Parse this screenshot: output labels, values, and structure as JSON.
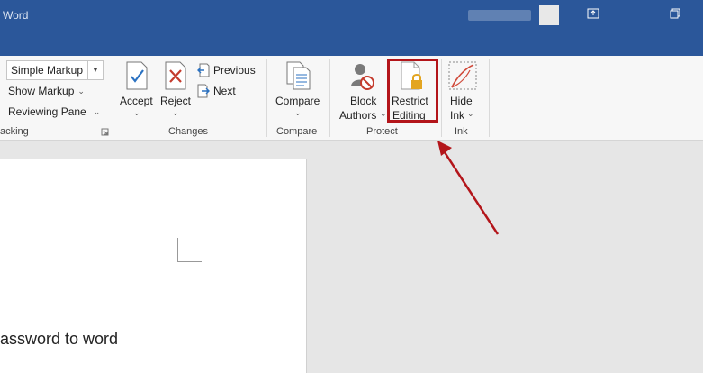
{
  "titlebar": {
    "app_name": "Word",
    "user_name": "",
    "icons": [
      "ribbon-display-icon",
      "restore-icon"
    ]
  },
  "ribbon": {
    "tracking": {
      "markup_select_value": "Simple Markup",
      "show_markup_label": "Show Markup",
      "reviewing_pane_label": "Reviewing Pane",
      "group_label": "acking"
    },
    "changes": {
      "accept_label": "Accept",
      "reject_label": "Reject",
      "previous_label": "Previous",
      "next_label": "Next",
      "group_label": "Changes"
    },
    "compare": {
      "compare_label": "Compare",
      "group_label": "Compare"
    },
    "protect": {
      "block_line1": "Block",
      "block_line2": "Authors",
      "restrict_line1": "Restrict",
      "restrict_line2": "Editing",
      "group_label": "Protect"
    },
    "ink": {
      "hide_line1": "Hide",
      "hide_line2": "Ink",
      "group_label": "Ink"
    }
  },
  "document": {
    "visible_text": "assword to word"
  },
  "colors": {
    "titlebar": "#2b579a",
    "highlight": "#b3151a",
    "ribbon_bg": "#f7f7f7"
  }
}
